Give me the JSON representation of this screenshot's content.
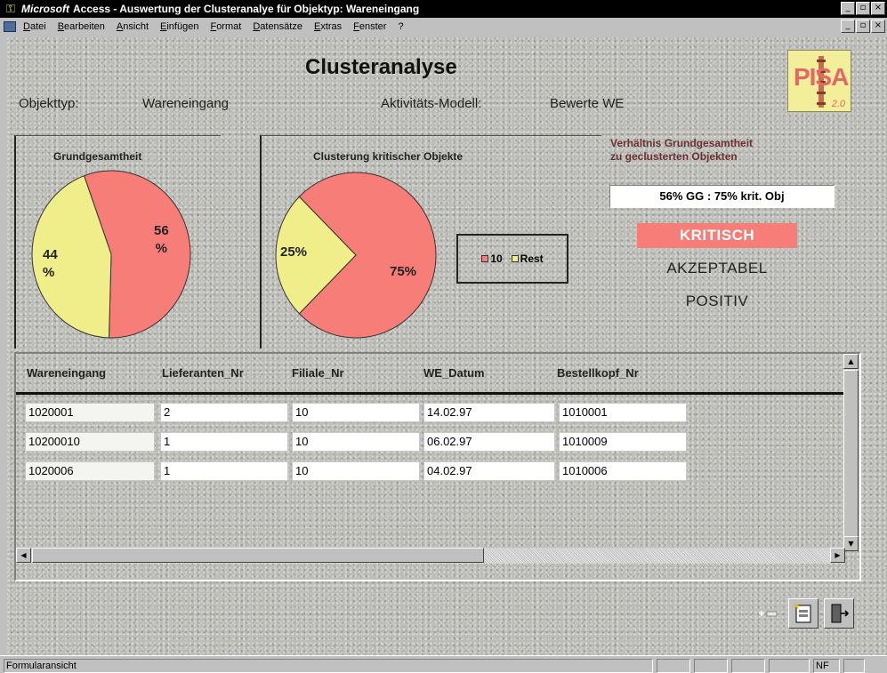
{
  "window": {
    "brand": "Microsoft",
    "title": "Access - Auswertung der Clusteranalye für Objektyp: Wareneingang",
    "min": "_",
    "max": "▫",
    "close": "×"
  },
  "menu": {
    "items": [
      "Datei",
      "Bearbeiten",
      "Ansicht",
      "Einfügen",
      "Format",
      "Datensätze",
      "Extras",
      "Fenster",
      "?"
    ]
  },
  "form": {
    "title": "Clusteranalyse",
    "objekttyp_label": "Objekttyp:",
    "objekttyp_value": "Wareneingang",
    "modell_label": "Aktivitäts-Modell:",
    "modell_value": "Bewerte WE",
    "logo": {
      "text": "PISA",
      "version": "2.0"
    }
  },
  "pie1": {
    "title": "Grundgesamtheit",
    "slices": [
      {
        "label": "56\n%",
        "value": 56,
        "color": "#f77e78"
      },
      {
        "label": "44\n%",
        "value": 44,
        "color": "#f0ee8a"
      }
    ]
  },
  "pie2": {
    "title": "Clusterung kritischer Objekte",
    "slices": [
      {
        "label": "75%",
        "value": 75,
        "color": "#f77e78"
      },
      {
        "label": "25%",
        "value": 25,
        "color": "#f0ee8a"
      }
    ],
    "legend": [
      {
        "label": "10",
        "color": "#f77e78"
      },
      {
        "label": "Rest",
        "color": "#f0ee8a"
      }
    ]
  },
  "ratio": {
    "label_line1": "Verhältnis Grundgesamtheit",
    "label_line2": "zu geclusterten Objekten",
    "value": "56% GG : 75% krit. Obj"
  },
  "statuses": [
    {
      "label": "KRITISCH",
      "active": true
    },
    {
      "label": "AKZEPTABEL",
      "active": false
    },
    {
      "label": "POSITIV",
      "active": false
    }
  ],
  "table": {
    "columns": [
      "Wareneingang",
      "Lieferanten_Nr",
      "Filiale_Nr",
      "WE_Datum",
      "Bestellkopf_Nr"
    ],
    "rows": [
      [
        "1020001",
        "2",
        "10",
        "14.02.97",
        "1010001"
      ],
      [
        "10200010",
        "1",
        "10",
        "06.02.97",
        "1010009"
      ],
      [
        "1020006",
        "1",
        "10",
        "04.02.97",
        "1010006"
      ]
    ]
  },
  "statusbar": {
    "text": "Formularansicht",
    "nf": "NF"
  }
}
